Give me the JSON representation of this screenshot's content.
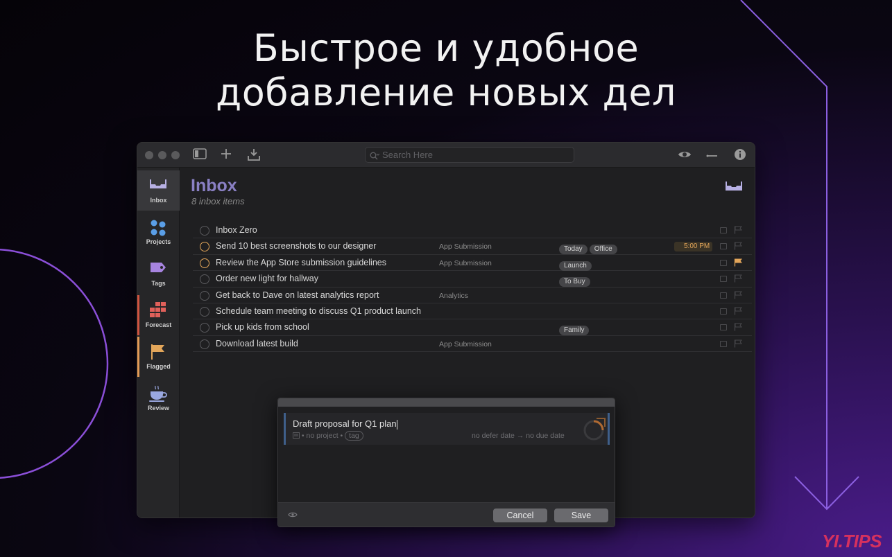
{
  "headline": {
    "line1": "Быстрое и удобное",
    "line2": "добавление новых дел"
  },
  "window": {
    "search_placeholder": "Search Here",
    "toolbar_icons": [
      "sidebar-toggle-icon",
      "plus-icon",
      "download-icon",
      "eye-icon",
      "minus-icon",
      "info-icon"
    ]
  },
  "sidebar": {
    "items": [
      {
        "label": "Inbox",
        "icon": "inbox-tray-icon",
        "active": true
      },
      {
        "label": "Projects",
        "icon": "projects-dots-icon"
      },
      {
        "label": "Tags",
        "icon": "tag-icon"
      },
      {
        "label": "Forecast",
        "icon": "calendar-grid-icon"
      },
      {
        "label": "Flagged",
        "icon": "flag-icon"
      },
      {
        "label": "Review",
        "icon": "coffee-cup-icon"
      }
    ],
    "colors": {
      "inbox": "#7e74b8",
      "projects": "#5a9ee6",
      "tags": "#a784e0",
      "forecast": "#e0605a",
      "flagged": "#e3a65a",
      "review": "#9aa8e0"
    }
  },
  "inbox": {
    "title": "Inbox",
    "subtitle": "8 inbox items",
    "accent": "#8a80c4"
  },
  "tasks": [
    {
      "title": "Inbox Zero",
      "project": "",
      "tags": [],
      "time": "",
      "due": false,
      "flagged": false
    },
    {
      "title": "Send 10 best screenshots to our designer",
      "project": "App Submission",
      "tags": [
        "Today",
        "Office"
      ],
      "time": "5:00 PM",
      "due": true,
      "flagged": false
    },
    {
      "title": "Review the App Store submission guidelines",
      "project": "App Submission",
      "tags": [
        "Launch"
      ],
      "time": "",
      "due": true,
      "flagged": true
    },
    {
      "title": "Order new light for hallway",
      "project": "",
      "tags": [
        "To Buy"
      ],
      "time": "",
      "due": false,
      "flagged": false
    },
    {
      "title": "Get back to Dave on latest analytics report",
      "project": "Analytics",
      "tags": [],
      "time": "",
      "due": false,
      "flagged": false
    },
    {
      "title": "Schedule team meeting to discuss Q1 product launch",
      "project": "",
      "tags": [],
      "time": "",
      "due": false,
      "flagged": false
    },
    {
      "title": "Pick up kids from school",
      "project": "",
      "tags": [
        "Family"
      ],
      "time": "",
      "due": false,
      "flagged": false
    },
    {
      "title": "Download latest build",
      "project": "App Submission",
      "tags": [],
      "time": "",
      "due": false,
      "flagged": false
    }
  ],
  "quick_entry": {
    "title": "Draft proposal for Q1 plan",
    "project": "no project",
    "tag": "tag",
    "defer": "no defer date",
    "arrow": "→",
    "due": "no due date",
    "cancel_label": "Cancel",
    "save_label": "Save"
  },
  "watermark": "YI.TIPS"
}
